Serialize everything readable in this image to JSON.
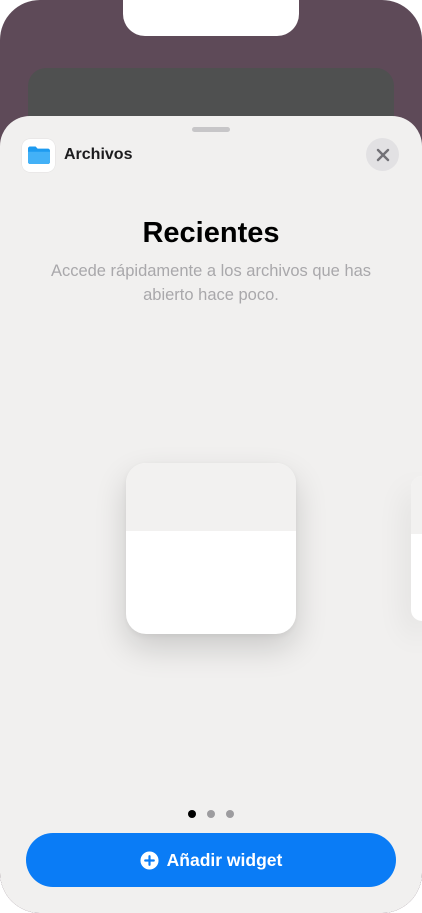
{
  "app": {
    "name": "Archivos",
    "icon": "folder-icon"
  },
  "close_icon": "close-icon",
  "widget_info": {
    "title": "Recientes",
    "description": "Accede rápidamente a los archivos que has abierto hace poco."
  },
  "pagination": {
    "total": 3,
    "current": 1
  },
  "add_button": {
    "label": "Añadir widget",
    "icon": "plus-circle-icon"
  },
  "colors": {
    "accent": "#0a7cf6",
    "folder": "#1d9bf0"
  }
}
